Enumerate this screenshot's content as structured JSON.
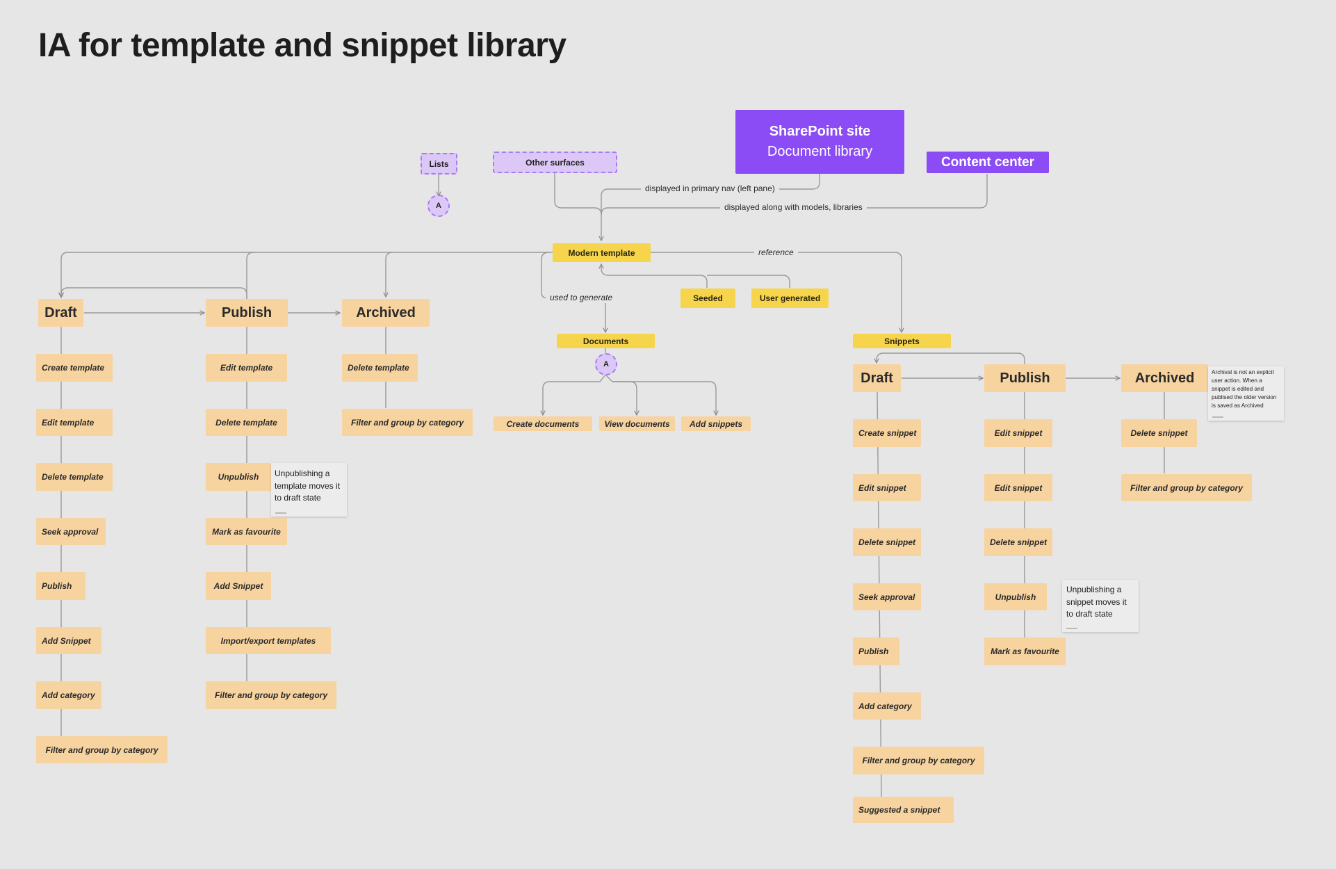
{
  "title": "IA for template and snippet library",
  "surfaces": {
    "lists": "Lists",
    "other_surfaces": "Other surfaces",
    "sharepoint_line1": "SharePoint site",
    "sharepoint_line2": "Document library",
    "content_center": "Content center"
  },
  "connectors": {
    "a1": "A",
    "a2": "A"
  },
  "hub": {
    "modern_template": "Modern template",
    "documents": "Documents",
    "snippets": "Snippets",
    "seeded": "Seeded",
    "user_generated": "User generated"
  },
  "edge_labels": {
    "primary_nav": "displayed in primary nav (left pane)",
    "along_models": "displayed along with models, libraries",
    "reference": "reference",
    "used_to_generate": "used to generate"
  },
  "documents_actions": [
    "Create documents",
    "View documents",
    "Add snippets"
  ],
  "template": {
    "draft": {
      "label": "Draft",
      "actions": [
        "Create template",
        "Edit template",
        "Delete template",
        "Seek approval",
        "Publish",
        "Add Snippet",
        "Add category",
        "Filter and group by category"
      ]
    },
    "publish": {
      "label": "Publish",
      "actions": [
        "Edit template",
        "Delete template",
        "Unpublish",
        "Mark as favourite",
        "Add Snippet",
        "Import/export templates",
        "Filter and group by category"
      ]
    },
    "archived": {
      "label": "Archived",
      "actions": [
        "Delete template",
        "Filter and group by category"
      ]
    }
  },
  "snippet": {
    "draft": {
      "label": "Draft",
      "actions": [
        "Create snippet",
        "Edit snippet",
        "Delete snippet",
        "Seek approval",
        "Publish",
        "Add category",
        "Filter and group by category",
        "Suggested a snippet"
      ]
    },
    "publish": {
      "label": "Publish",
      "actions": [
        "Edit snippet",
        "Edit snippet",
        "Delete snippet",
        "Unpublish",
        "Mark as favourite"
      ]
    },
    "archived": {
      "label": "Archived",
      "actions": [
        "Delete snippet",
        "Filter and group by category"
      ]
    }
  },
  "notes": {
    "template_unpublish": "Unpublishing a\ntemplate moves it\nto draft state",
    "snippet_unpublish": "Unpublishing a\nsnippet moves it\nto draft state",
    "archival": "Archival is not an explicit\nuser action. When a\nsnippet is edited and\npublised the older version\nis saved as Archived"
  },
  "colors": {
    "background": "#e6e6e6",
    "state_fill": "#f7d3a0",
    "hub_fill": "#f6d54d",
    "surface_purple": "#8b4cf5",
    "dashed_fill": "#dcc8f7",
    "edge": "#9a9a9a"
  }
}
